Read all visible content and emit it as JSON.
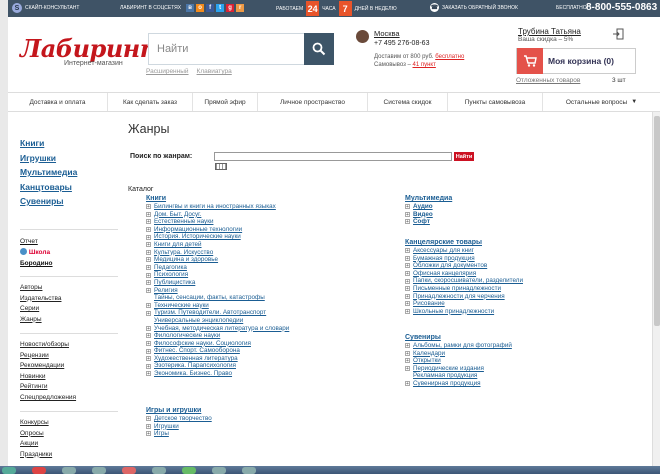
{
  "topbar": {
    "skype_label": "СКАЙП-КОНСУЛЬТАНТ",
    "social_label": "ЛАБИРИНТ В СОЦСЕТЯХ",
    "work_label": "РАБОТАЕМ",
    "hours": "24",
    "hours_label": "ЧАСА",
    "days": "7",
    "days_label": "ДНЕЙ В НЕДЕЛЮ",
    "callback_label": "ЗАКАЗАТЬ ОБРАТНЫЙ ЗВОНОК",
    "free_label": "БЕСПЛАТНО:",
    "phone": "8-800-555-0863"
  },
  "header": {
    "logo": "Лабиринт",
    "logo_sub": "Интернет-магазин",
    "search_placeholder": "Найти",
    "search_link_1": "Расширенный",
    "search_link_2": "Клавиатура",
    "city": "Москва",
    "city_phone": "+7 495 276-08-63",
    "delivery_text": "Доставим от 800 руб.",
    "delivery_free": "бесплатно",
    "pickup_text": "Самовывоз –",
    "pickup_points": "41 пункт",
    "user_name": "Трубина Татьяна",
    "user_discount": "Ваша скидка – 5%",
    "cart_label": "Моя корзина (0)",
    "deferred_label": "Отложенных товаров",
    "deferred_count": "3 шт"
  },
  "nav": [
    "Доставка и оплата",
    "Как сделать заказ",
    "Прямой эфир",
    "Личное пространство",
    "Система скидок",
    "Пункты самовывоза",
    "Остальные вопросы"
  ],
  "sidebar": {
    "main": [
      "Книги",
      "Игрушки",
      "Мультимедиа",
      "Канцтовары",
      "Сувениры"
    ],
    "report": "Отчет",
    "school": "Школа",
    "borodino": "Бородино",
    "list1": [
      "Авторы",
      "Издательства",
      "Серии",
      "Жанры"
    ],
    "list2": [
      "Новости/обзоры",
      "Рецензии",
      "Рекомендации",
      "Новинки",
      "Рейтинги",
      "Спецпредложения"
    ],
    "list3": [
      "Конкурсы",
      "Опросы",
      "Акции",
      "Праздники"
    ]
  },
  "main": {
    "title": "Жанры",
    "search_label": "Поиск по жанрам:",
    "search_button": "Найти",
    "catalog_label": "Каталог"
  },
  "catalog": {
    "books_head": "Книги",
    "books": [
      "Билингвы и книги на иностранных языках",
      "Дом. Быт. Досуг.",
      "Естественные науки",
      "Информационные технологии",
      "История. Исторические науки",
      "Книги для детей",
      "Культура. Искусство",
      "Медицина и здоровье",
      "Педагогика",
      "Психология",
      "Публицистика",
      "Религия",
      "Тайны, сенсации, факты, катастрофы",
      "Технические науки",
      "Туризм. Путеводители. Автотранспорт",
      "Универсальные энциклопедии",
      "Учебная, методическая литература и словари",
      "Филологические науки",
      "Философские науки. Социология",
      "Фитнес. Спорт. Самооборона",
      "Художественная литература",
      "Эзотерика. Парапсихология",
      "Экономика. Бизнес. Право"
    ],
    "books_nolink": [
      12,
      15
    ],
    "toys_head": "Игры и игрушки",
    "toys": [
      "Детское творчество",
      "Игрушки",
      "Игры"
    ],
    "media_head": "Мультимедиа",
    "media": [
      "Аудио",
      "Видео",
      "Софт"
    ],
    "office_head": "Канцелярские товары",
    "office": [
      "Аксессуары для книг",
      "Бумажная продукция",
      "Обложки для документов",
      "Офисная канцелярия",
      "Папки, скоросшиватели, разделители",
      "Письменные принадлежности",
      "Принадлежности для черчения",
      "Рисование",
      "Школьные принадлежности"
    ],
    "souvenirs_head": "Сувениры",
    "souvenirs": [
      "Альбомы, рамки для фотографий",
      "Календари",
      "Открытки",
      "Периодические издания",
      "Рекламная продукция",
      "Сувенирная продукция"
    ],
    "souvenirs_nolink": [
      4
    ]
  },
  "colors": {
    "topbar": "#3f5366",
    "accent_red": "#c4161c",
    "link_blue": "#1a5d93",
    "badge_orange": "#e8542a"
  }
}
